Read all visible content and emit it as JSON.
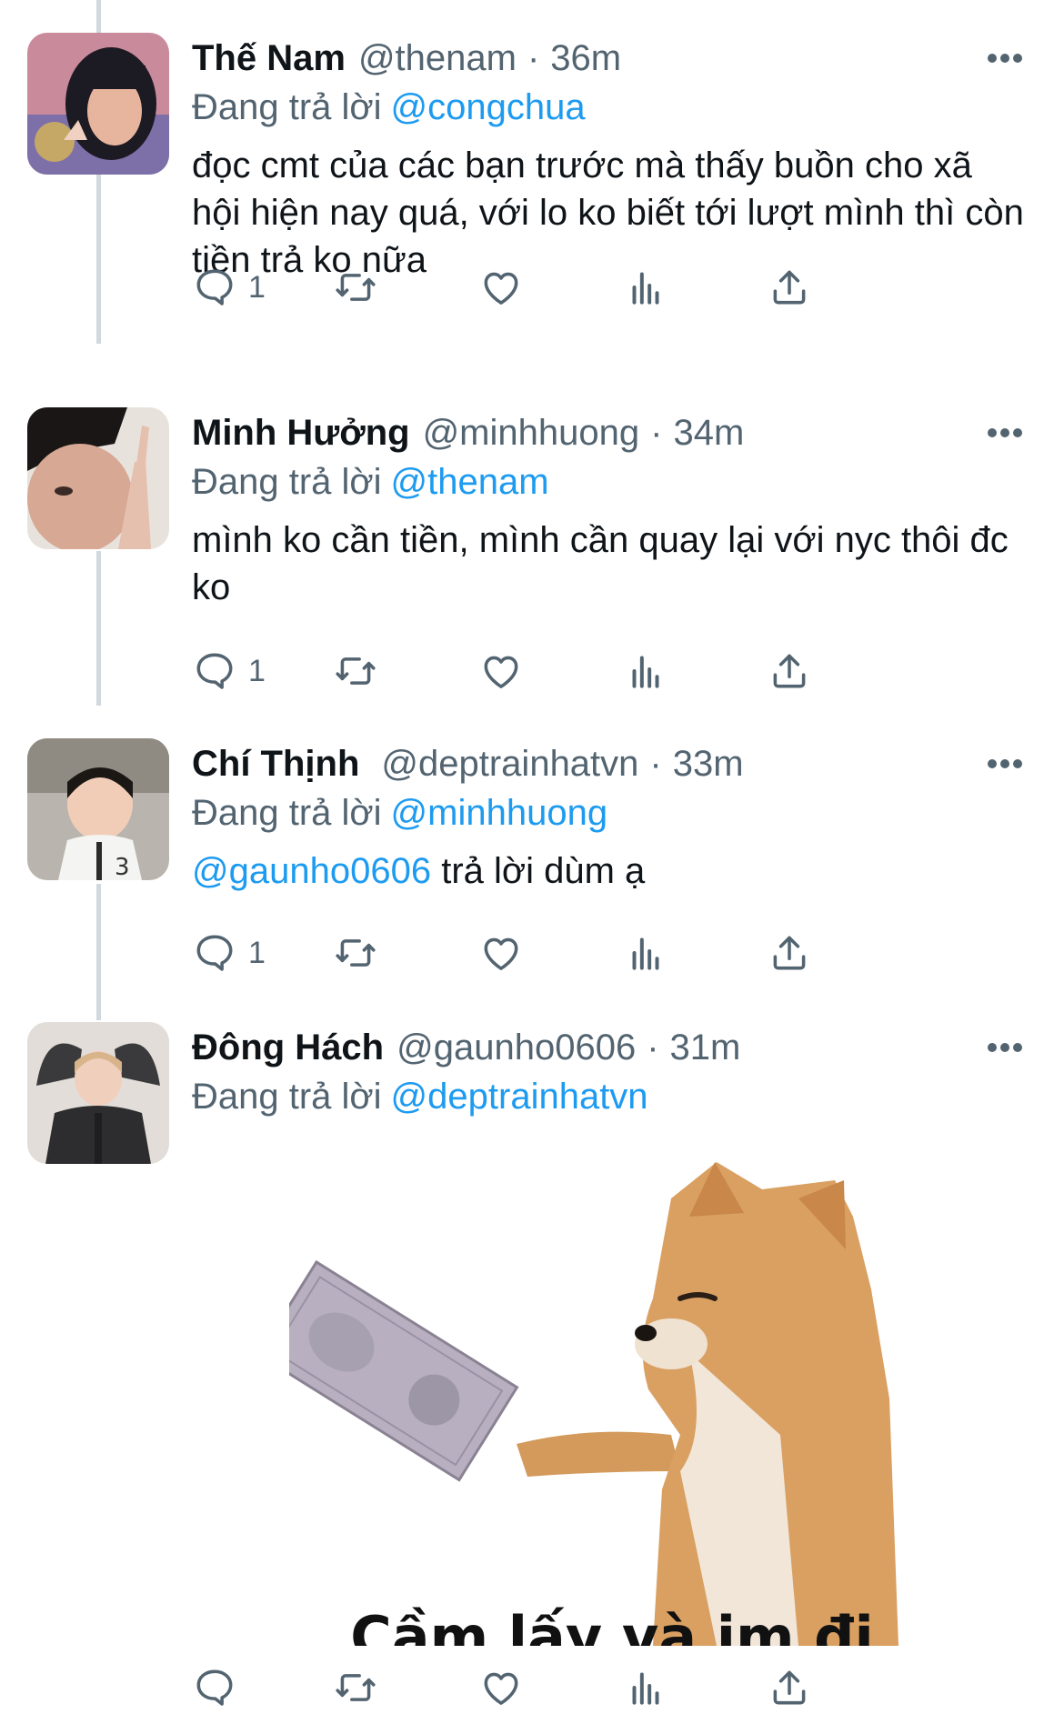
{
  "colors": {
    "link": "#1d9bf0",
    "secondary_text": "#536471",
    "primary_text": "#0f1419",
    "thread_line": "#cfd9de"
  },
  "icons": {
    "reply": "speech-bubble-icon",
    "retweet": "retweet-icon",
    "like": "heart-icon",
    "views": "bar-chart-icon",
    "share": "share-upload-icon",
    "more": "three-dots-icon"
  },
  "tweets": [
    {
      "name": "Thế Nam",
      "handle": "@thenam",
      "separator": "·",
      "time": "36m",
      "replying_label": "Đang trả lời",
      "replying_to": "@congchua",
      "text": "đọc cmt của các bạn trước mà thấy buồn cho xã hội hiện nay quá, với lo ko biết tới lượt mình thì còn tiền trả ko nữa",
      "reply_count": "1"
    },
    {
      "name": "Minh Hưởng",
      "handle": "@minhhuong",
      "separator": "·",
      "time": "34m",
      "replying_label": "Đang trả lời",
      "replying_to": "@thenam",
      "text": "mình ko cần tiền, mình cần quay lại với nyc thôi đc ko",
      "reply_count": "1"
    },
    {
      "name": "Chí Thịnh",
      "handle": "@deptrainhatvn",
      "separator": "·",
      "time": "33m",
      "replying_label": "Đang trả lời",
      "replying_to": "@minhhuong",
      "text_mention": "@gaunho0606",
      "text": "trả lời dùm ạ",
      "reply_count": "1"
    },
    {
      "name": "Đông Hách",
      "handle": "@gaunho0606",
      "separator": "·",
      "time": "31m",
      "replying_label": "Đang trả lời",
      "replying_to": "@deptrainhatvn",
      "media_caption": "Cầm lấy và im đi",
      "reply_count": ""
    }
  ]
}
